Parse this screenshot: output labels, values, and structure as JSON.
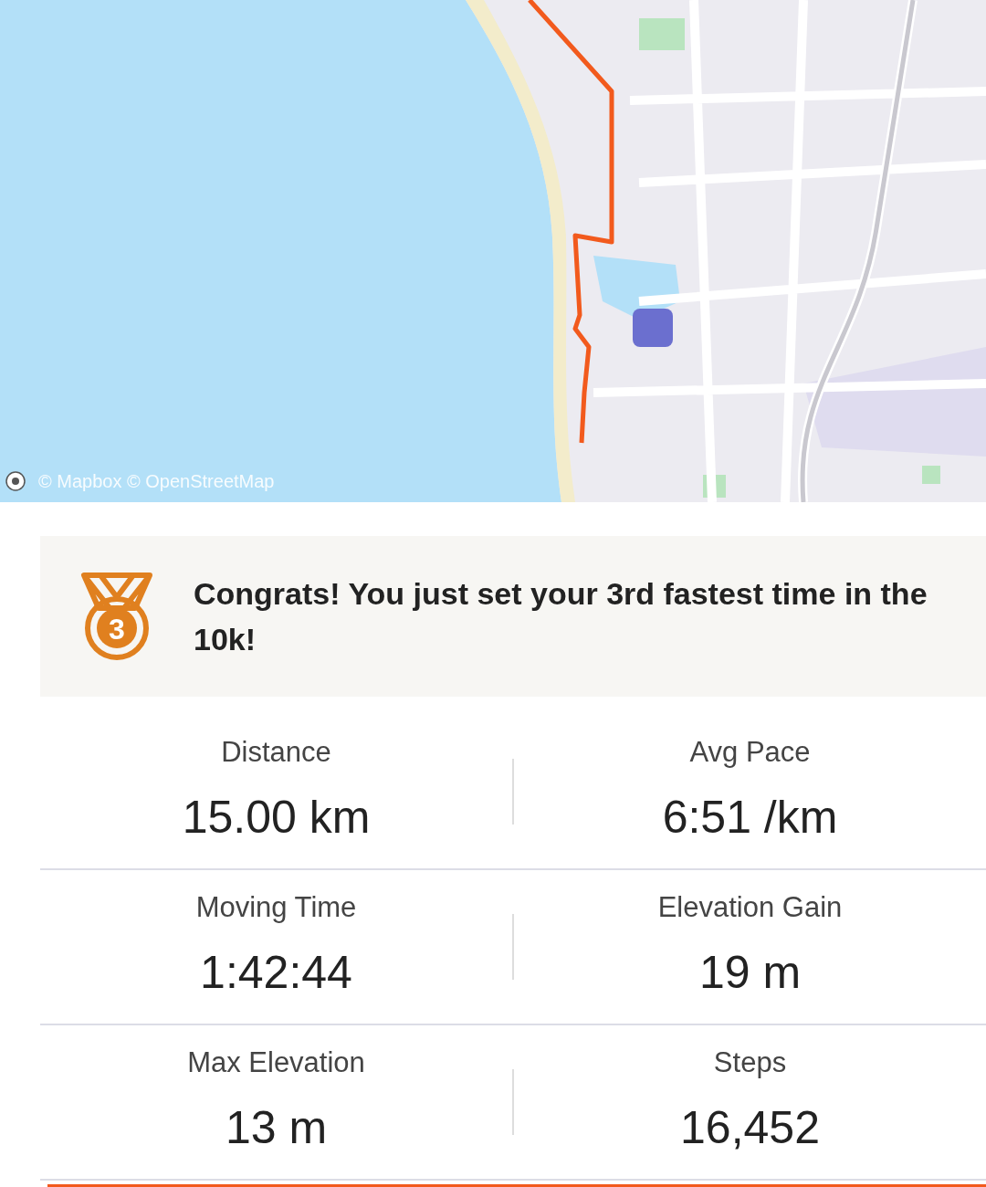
{
  "map": {
    "attribution": "© Mapbox © OpenStreetMap"
  },
  "achievement": {
    "rank": "3",
    "message": "Congrats! You just set your 3rd fastest time in the 10k!"
  },
  "stats": [
    {
      "label": "Distance",
      "value": "15.00 km"
    },
    {
      "label": "Avg Pace",
      "value": "6:51 /km"
    },
    {
      "label": "Moving Time",
      "value": "1:42:44"
    },
    {
      "label": "Elevation Gain",
      "value": "19 m"
    },
    {
      "label": "Max Elevation",
      "value": "13 m"
    },
    {
      "label": "Steps",
      "value": "16,452"
    }
  ]
}
